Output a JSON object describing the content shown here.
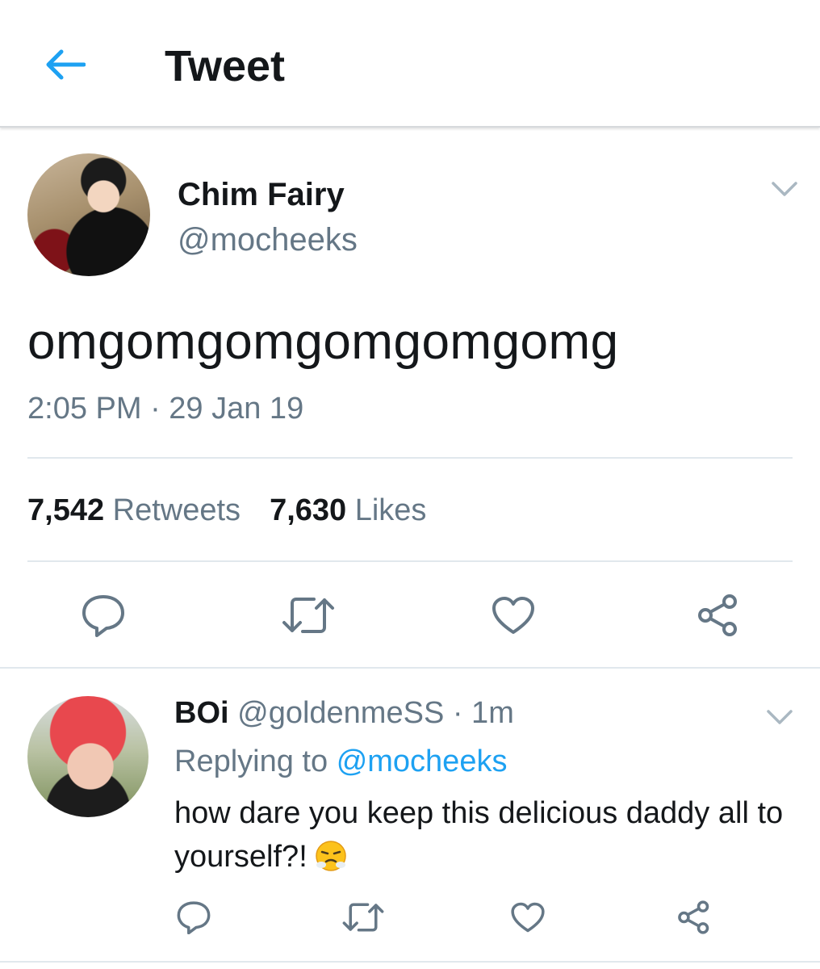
{
  "header": {
    "title": "Tweet",
    "back_icon": "arrow-left-icon",
    "accent_color": "#1da1f2"
  },
  "tweet": {
    "display_name": "Chim Fairy",
    "handle": "@mocheeks",
    "text": "omgomgomgomgomgomg",
    "timestamp": "2:05 PM · 29 Jan 19",
    "stats": {
      "retweets_count": "7,542",
      "retweets_label": "Retweets",
      "likes_count": "7,630",
      "likes_label": "Likes"
    },
    "actions": [
      "reply-icon",
      "retweet-icon",
      "like-icon",
      "share-icon"
    ]
  },
  "reply": {
    "display_name": "BOi",
    "handle_time": "@goldenmeSS · 1m",
    "replying_prefix": "Replying to",
    "replying_to": "@mocheeks",
    "text": "how dare you keep this delicious daddy all to yourself?!",
    "emoji": "face-with-steam-from-nose",
    "actions": [
      "reply-icon",
      "retweet-icon",
      "like-icon",
      "share-icon"
    ]
  },
  "colors": {
    "primary_text": "#14171a",
    "secondary_text": "#657786",
    "divider": "#e1e8ed",
    "icon": "#657786"
  }
}
